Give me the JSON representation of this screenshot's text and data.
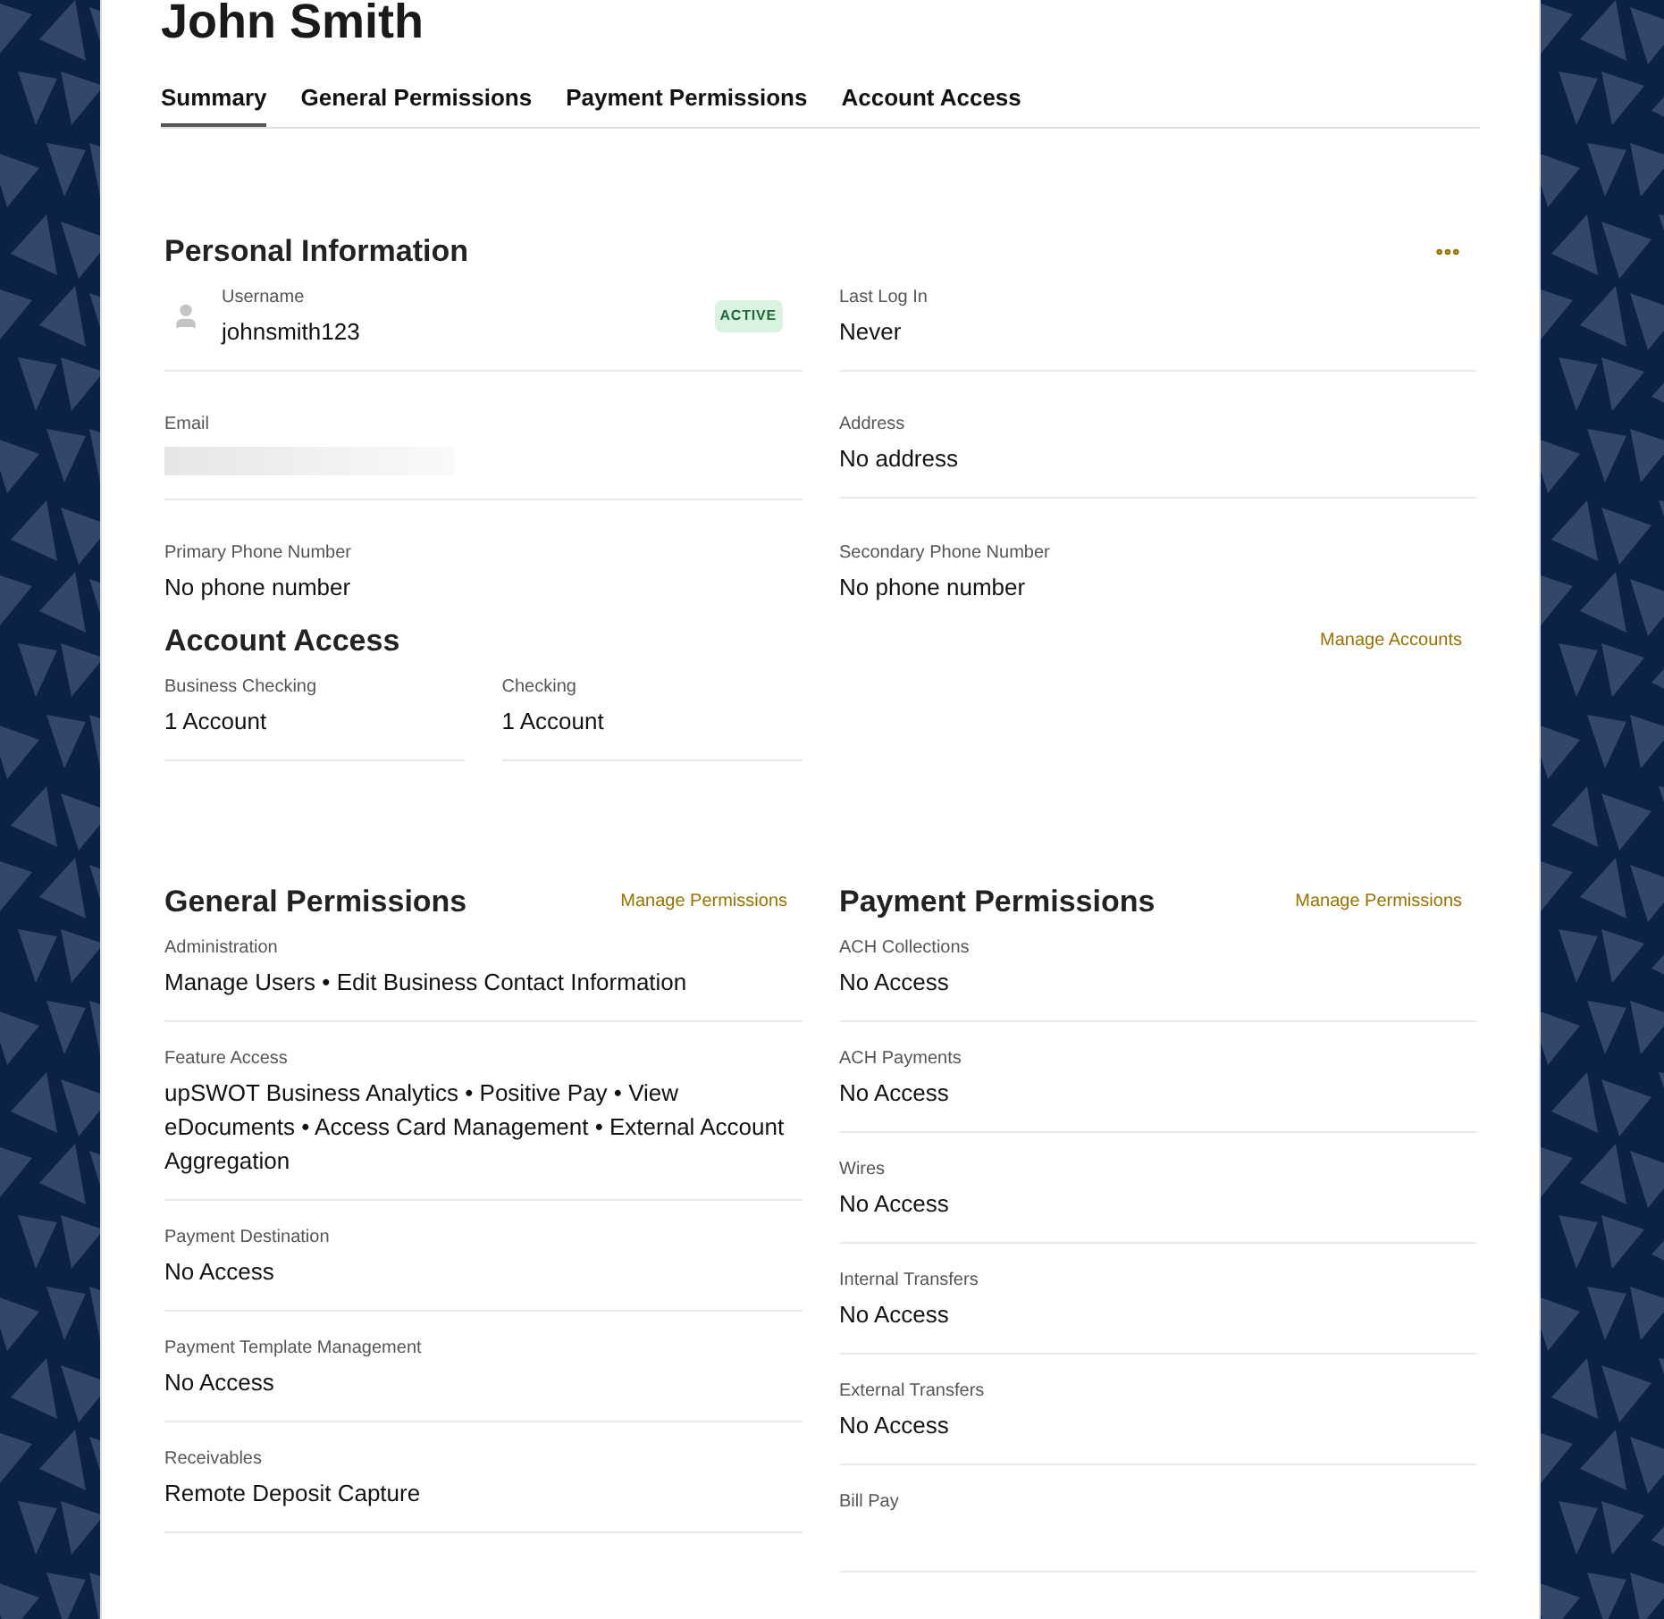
{
  "page_title": "John Smith",
  "tabs": [
    {
      "label": "Summary",
      "selected": true
    },
    {
      "label": "General Permissions",
      "selected": false
    },
    {
      "label": "Payment Permissions",
      "selected": false
    },
    {
      "label": "Account Access",
      "selected": false
    }
  ],
  "personal_information": {
    "title": "Personal Information",
    "username": {
      "label": "Username",
      "value": "johnsmith123",
      "status": "ACTIVE"
    },
    "fields": [
      {
        "label": "Last Log In",
        "value": "Never",
        "kind": "text"
      },
      {
        "label": "Email",
        "kind": "redacted"
      },
      {
        "label": "Address",
        "value": "No address",
        "kind": "text"
      },
      {
        "label": "Primary Phone Number",
        "value": "No phone number",
        "kind": "text"
      },
      {
        "label": "Secondary Phone Number",
        "value": "No phone number",
        "kind": "text"
      }
    ]
  },
  "account_access": {
    "title": "Account Access",
    "link": "Manage Accounts",
    "items": [
      {
        "label": "Business Checking",
        "value": "1 Account"
      },
      {
        "label": "Checking",
        "value": "1 Account"
      }
    ]
  },
  "general_permissions": {
    "title": "General Permissions",
    "link": "Manage Permissions",
    "items": [
      {
        "label": "Administration",
        "value": "Manage Users • Edit Business Contact Information"
      },
      {
        "label": "Feature Access",
        "value": "upSWOT Business Analytics • Positive Pay • View eDocuments • Access Card Management • External Account Aggregation"
      },
      {
        "label": "Payment Destination",
        "value": "No Access"
      },
      {
        "label": "Payment Template Management",
        "value": "No Access"
      },
      {
        "label": "Receivables",
        "value": "Remote Deposit Capture"
      }
    ]
  },
  "payment_permissions": {
    "title": "Payment Permissions",
    "link": "Manage Permissions",
    "items": [
      {
        "label": "ACH Collections",
        "value": "No Access"
      },
      {
        "label": "ACH Payments",
        "value": "No Access"
      },
      {
        "label": "Wires",
        "value": "No Access"
      },
      {
        "label": "Internal Transfers",
        "value": "No Access"
      },
      {
        "label": "External Transfers",
        "value": "No Access"
      },
      {
        "label": "Bill Pay"
      }
    ]
  }
}
